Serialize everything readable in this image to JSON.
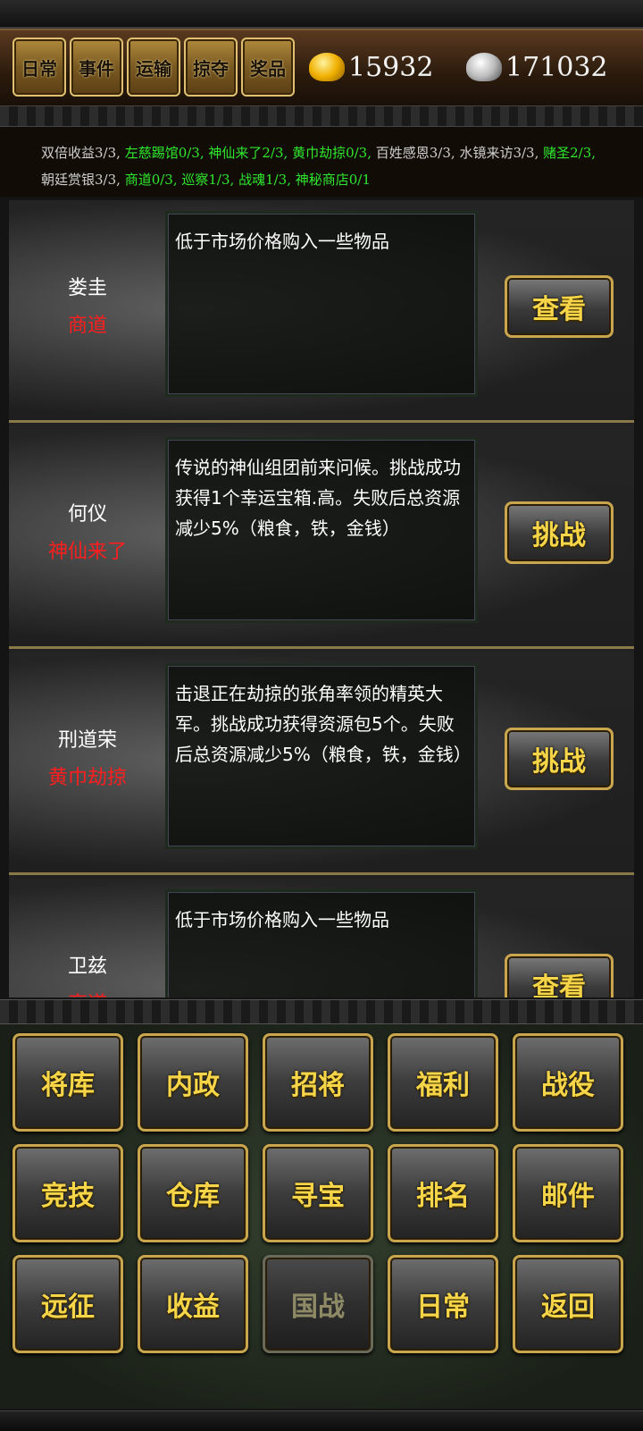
{
  "header": {
    "tabs": [
      "日常",
      "事件",
      "运输",
      "掠夺",
      "奖品"
    ],
    "gold": "15932",
    "silver": "171032"
  },
  "status": [
    {
      "text": "双倍收益3/3,",
      "color": "gray"
    },
    {
      "text": " 左慈踢馆0/3,",
      "color": "green"
    },
    {
      "text": " 神仙来了2/3,",
      "color": "green"
    },
    {
      "text": " 黄巾劫掠0/3,",
      "color": "green"
    },
    {
      "text": " 百姓感恩3/3,",
      "color": "gray"
    },
    {
      "text": " 水镜来访3/3,",
      "color": "gray"
    },
    {
      "text": " 赌圣2/3,",
      "color": "green"
    },
    {
      "text": " 朝廷赏银3/3,",
      "color": "gray"
    },
    {
      "text": " 商道0/3,",
      "color": "green"
    },
    {
      "text": " 巡察1/3,",
      "color": "green"
    },
    {
      "text": " 战魂1/3,",
      "color": "green"
    },
    {
      "text": " 神秘商店0/1",
      "color": "green"
    }
  ],
  "events": [
    {
      "name": "娄圭",
      "type": "商道",
      "desc": "低于市场价格购入一些物品",
      "action": "查看"
    },
    {
      "name": "何仪",
      "type": "神仙来了",
      "desc": "传说的神仙组团前来问候。挑战成功获得1个幸运宝箱.高。失败后总资源减少5%（粮食，铁，金钱）",
      "action": "挑战"
    },
    {
      "name": "刑道荣",
      "type": "黄巾劫掠",
      "desc": "击退正在劫掠的张角率领的精英大军。挑战成功获得资源包5个。失败后总资源减少5%（粮食，铁，金钱）",
      "action": "挑战"
    },
    {
      "name": "卫兹",
      "type": "商道",
      "desc": "低于市场价格购入一些物品",
      "action": "查看"
    }
  ],
  "menu": [
    [
      "将库",
      "内政",
      "招将",
      "福利",
      "战役"
    ],
    [
      "竞技",
      "仓库",
      "寻宝",
      "排名",
      "邮件"
    ],
    [
      "远征",
      "收益",
      "国战",
      "日常",
      "返回"
    ]
  ],
  "menu_disabled": "国战",
  "colors": {
    "accent_gold": "#f7d548",
    "status_green": "#2ee82e",
    "event_type_red": "#ff1e1e"
  },
  "icons": {
    "gold": "gold-ingot-icon",
    "silver": "silver-ingot-icon"
  }
}
